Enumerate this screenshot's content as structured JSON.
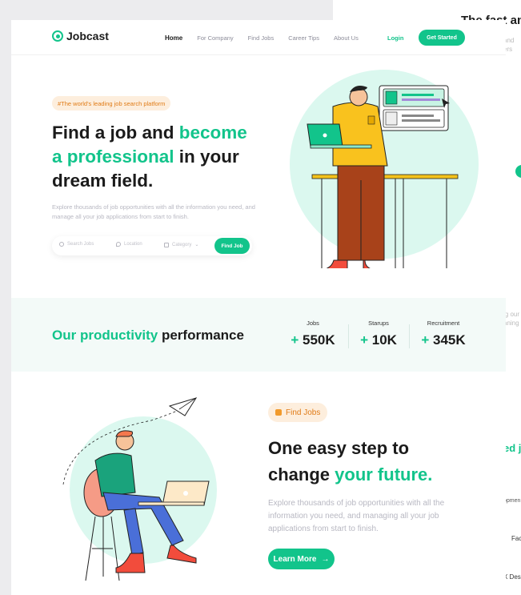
{
  "background_card": {
    "title": "The fast and",
    "ghost_texts": [
      "and",
      "ers",
      "ig our",
      "aning",
      "ed jo",
      "Fac",
      "X Des",
      "opmen"
    ]
  },
  "nav": {
    "logo": "Jobcast",
    "links": [
      "Home",
      "For Company",
      "Find Jobs",
      "Career Tips",
      "About Us"
    ],
    "login": "Login",
    "cta": "Get Started"
  },
  "hero": {
    "pill": "#The world's leading job search platform",
    "title_parts": [
      "Find a job and ",
      "become",
      "a professional",
      " in your",
      "dream field."
    ],
    "subtitle": "Explore thousands of job opportunities with all the information you need, and manage all your job applications from start to finish.",
    "search": {
      "job_placeholder": "Search Jobs",
      "location_placeholder": "Location",
      "category_placeholder": "Category",
      "button": "Find Job"
    }
  },
  "stats": {
    "title_green": "Our productivity",
    "title_rest": " performance",
    "items": [
      {
        "label": "Jobs",
        "plus": "+",
        "value": "550K"
      },
      {
        "label": "Starups",
        "plus": "+",
        "value": "10K"
      },
      {
        "label": "Recruitment",
        "plus": "+",
        "value": "345K"
      }
    ]
  },
  "feature": {
    "pill": "Find Jobs",
    "title_line1": "One easy step to",
    "title_line2_plain": "change ",
    "title_line2_green": "your future.",
    "subtitle": "Explore thousands of job opportunities with all the information you need, and managing all your job applications from start to finish.",
    "button": "Learn More",
    "button_icon": "arrow-right-icon"
  },
  "colors": {
    "accent": "#12c48b",
    "pill_bg": "#fdeedd",
    "pill_text": "#e07b16",
    "stats_bg": "#f3faf8"
  }
}
